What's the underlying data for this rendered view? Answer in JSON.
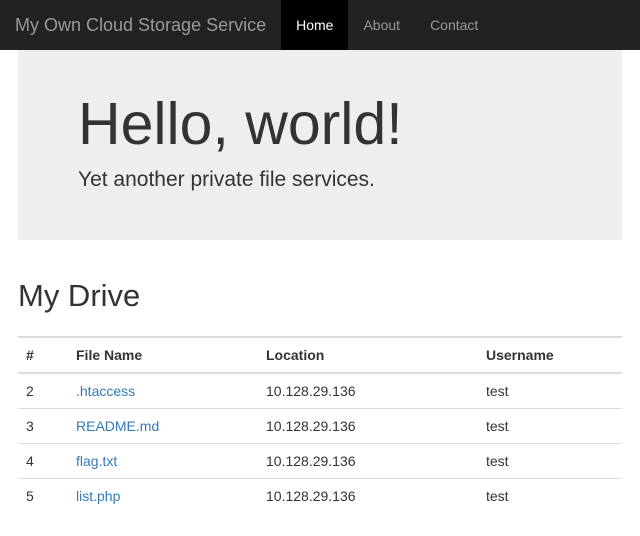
{
  "nav": {
    "brand": "My Own Cloud Storage Service",
    "items": [
      {
        "label": "Home",
        "active": true
      },
      {
        "label": "About",
        "active": false
      },
      {
        "label": "Contact",
        "active": false
      }
    ]
  },
  "hero": {
    "title": "Hello, world!",
    "subtitle": "Yet another private file services."
  },
  "drive": {
    "heading": "My Drive",
    "columns": {
      "index": "#",
      "filename": "File Name",
      "location": "Location",
      "username": "Username"
    },
    "rows": [
      {
        "index": "2",
        "filename": ".htaccess",
        "location": "10.128.29.136",
        "username": "test"
      },
      {
        "index": "3",
        "filename": "README.md",
        "location": "10.128.29.136",
        "username": "test"
      },
      {
        "index": "4",
        "filename": "flag.txt",
        "location": "10.128.29.136",
        "username": "test"
      },
      {
        "index": "5",
        "filename": "list.php",
        "location": "10.128.29.136",
        "username": "test"
      }
    ]
  }
}
